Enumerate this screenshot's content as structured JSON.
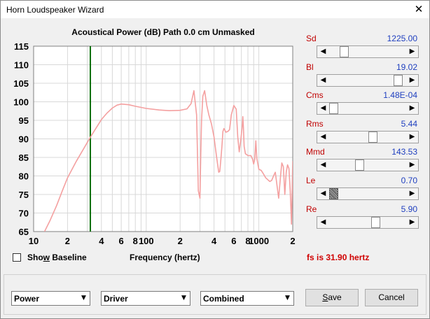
{
  "window": {
    "title": "Horn Loudspeaker Wizard",
    "close_symbol": "✕"
  },
  "chart_data": {
    "type": "line",
    "title": "Acoustical Power (dB)   Path 0.0 cm   Unmasked",
    "xlabel": "Frequency (hertz)",
    "ylabel": "",
    "x_scale": "log",
    "xlim": [
      10,
      2000
    ],
    "ylim": [
      65,
      115
    ],
    "x_tick_labels": [
      "10",
      "2",
      "4",
      "6",
      "8",
      "100",
      "2",
      "4",
      "6",
      "8",
      "1000",
      "2"
    ],
    "x_tick_values": [
      10,
      20,
      40,
      60,
      80,
      100,
      200,
      400,
      600,
      800,
      1000,
      2000
    ],
    "y_ticks": [
      65,
      70,
      75,
      80,
      85,
      90,
      95,
      100,
      105,
      110,
      115
    ],
    "grid": true,
    "marker_line": {
      "x": 31.9,
      "color": "#007000"
    },
    "series": [
      {
        "color": "#f4a0a0",
        "x": [
          12.5,
          14,
          16,
          18,
          20,
          24,
          28,
          32,
          36,
          40,
          45,
          50,
          55,
          60,
          70,
          80,
          100,
          130,
          160,
          200,
          230,
          250,
          265,
          280,
          290,
          300,
          305,
          310,
          318,
          330,
          345,
          360,
          380,
          400,
          420,
          440,
          450,
          460,
          470,
          480,
          490,
          500,
          510,
          530,
          550,
          570,
          600,
          630,
          650,
          670,
          690,
          710,
          720,
          730,
          740,
          760,
          800,
          850,
          880,
          900,
          920,
          940,
          960,
          1000,
          1050,
          1100,
          1150,
          1200,
          1250,
          1300,
          1350,
          1400,
          1450,
          1500,
          1560,
          1600,
          1650,
          1700,
          1750,
          1800,
          1850,
          1900,
          1950,
          2000
        ],
        "y": [
          65,
          68,
          72,
          76,
          79.5,
          84,
          87.5,
          90.5,
          93,
          95.2,
          97,
          98.3,
          99.1,
          99.4,
          99.2,
          98.8,
          98.2,
          97.8,
          97.6,
          97.7,
          98.1,
          99.5,
          103,
          96.5,
          76,
          74,
          86,
          95,
          101.5,
          103,
          99,
          96.5,
          94,
          90.5,
          85.5,
          81,
          81.2,
          84.5,
          88,
          92,
          92.8,
          92.3,
          91.8,
          92,
          92.5,
          96.5,
          99,
          98,
          90.5,
          86.5,
          89.5,
          93,
          96,
          93,
          88,
          86,
          85.5,
          85.5,
          84.5,
          83.2,
          84.5,
          89.5,
          84.8,
          81.8,
          81.5,
          80.5,
          79.5,
          79,
          78.5,
          78.8,
          80,
          81,
          77.5,
          74,
          80,
          83.5,
          82.5,
          75,
          81,
          83,
          82,
          76,
          67,
          84
        ]
      }
    ]
  },
  "params": [
    {
      "name": "Sd",
      "value": "1225.00",
      "level": 0.15
    },
    {
      "name": "Bl",
      "value": "19.02",
      "level": 0.95
    },
    {
      "name": "Cms",
      "value": "1.48E-04",
      "level": 0.0
    },
    {
      "name": "Rms",
      "value": "5.44",
      "level": 0.58
    },
    {
      "name": "Mmd",
      "value": "143.53",
      "level": 0.38
    },
    {
      "name": "Le",
      "value": "0.70",
      "level": 0.0
    },
    {
      "name": "Re",
      "value": "5.90",
      "level": 0.62
    }
  ],
  "baseline": {
    "label_before": "Sho",
    "label_underlined": "w",
    "label_after": " Baseline",
    "checked": false
  },
  "fs_text": "fs is 31.90 hertz",
  "selects": [
    {
      "value": "Power"
    },
    {
      "value": "Driver"
    },
    {
      "value": "Combined"
    }
  ],
  "buttons": {
    "save": {
      "underlined": "S",
      "rest": "ave"
    },
    "cancel": "Cancel"
  },
  "colors": {
    "curve": "#f4a0a0",
    "marker": "#007000",
    "param_name": "#c00000",
    "param_value": "#1f3fbf",
    "fs_text": "#d00000"
  }
}
